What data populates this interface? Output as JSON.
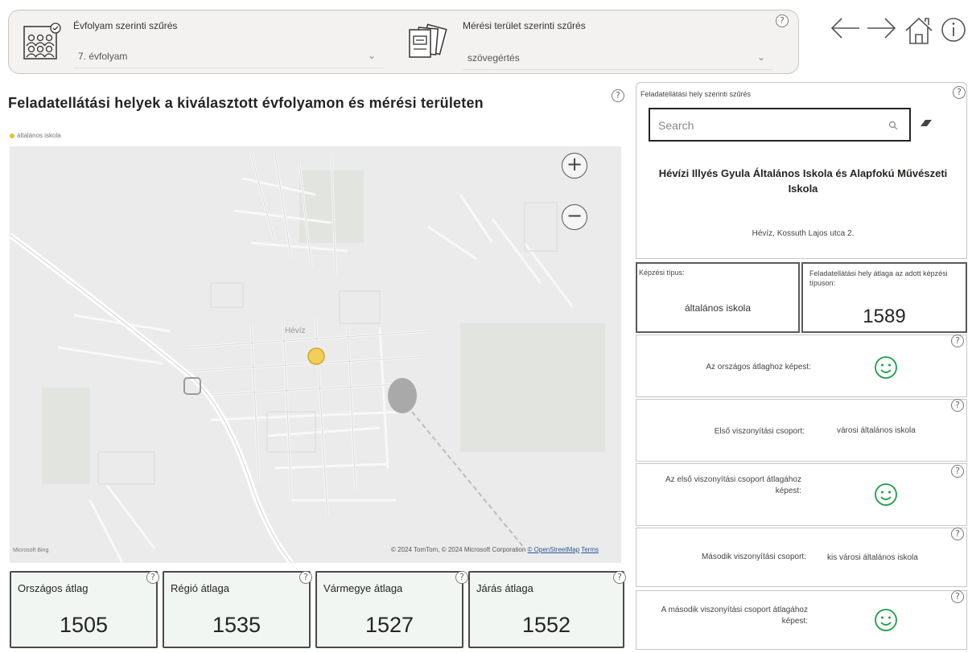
{
  "filters": {
    "grade": {
      "label": "Évfolyam szerinti szűrés",
      "value": "7. évfolyam"
    },
    "area": {
      "label": "Mérési terület szerinti szűrés",
      "value": "szövegértés"
    },
    "help": "?"
  },
  "nav": {
    "back_icon": "arrow-left-icon",
    "forward_icon": "arrow-right-icon",
    "home_icon": "home-icon",
    "info_icon": "info-icon"
  },
  "map": {
    "title": "Feladatellátási helyek a kiválasztott évfolyamon és mérési területen",
    "legend": "általános iskola",
    "legend_color": "#e6c229",
    "place_label": "Hévíz",
    "logo": "Microsoft Bing",
    "attribution": "© 2024 TomTom, © 2024 Microsoft Corporation",
    "osm_link": "© OpenStreetMap",
    "terms_link": "Terms",
    "zoom_in": "+",
    "zoom_out": "−"
  },
  "averages": [
    {
      "title": "Országos átlag",
      "value": "1505"
    },
    {
      "title": "Régió átlaga",
      "value": "1535"
    },
    {
      "title": "Vármegye átlaga",
      "value": "1527"
    },
    {
      "title": "Járás átlaga",
      "value": "1552"
    }
  ],
  "right": {
    "filter_title": "Feladatellátási hely szerinti szűrés",
    "search_placeholder": "Search",
    "school_name": "Hévízi Illyés Gyula Általános Iskola és Alapfokú Művészeti Iskola",
    "school_address": "Hévíz, Kossuth Lajos utca 2.",
    "training_type_label": "Képzési típus:",
    "training_type_value": "általános iskola",
    "site_avg_label": "Feladatellátási hely átlaga az adott képzési típuson:",
    "site_avg_value": "1589",
    "national_compare_label": "Az országos átlaghoz képest:",
    "first_group_label": "Első viszonyítási csoport:",
    "first_group_value": "városi általános iskola",
    "first_compare_label": "Az első viszonyítási csoport átlagához képest:",
    "second_group_label": "Második viszonyítási csoport:",
    "second_group_value": "kis városi általános iskola",
    "second_compare_label": "A második viszonyítási csoport átlagához képest:",
    "smiley_color": "#1e9e4a"
  }
}
